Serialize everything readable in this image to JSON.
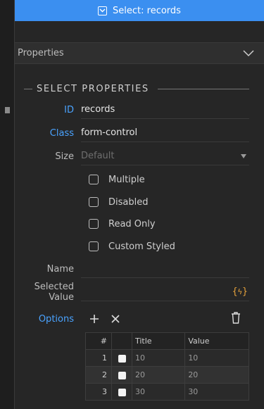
{
  "banner": {
    "label": "Select: records"
  },
  "panel": {
    "title": "Properties"
  },
  "section": {
    "title": "SELECT PROPERTIES"
  },
  "fields": {
    "id": {
      "label": "ID",
      "value": "records"
    },
    "class": {
      "label": "Class",
      "value": "form-control"
    },
    "size": {
      "label": "Size",
      "value": "Default"
    },
    "name": {
      "label": "Name",
      "value": ""
    },
    "selected_value": {
      "label": "Selected Value",
      "value": ""
    }
  },
  "checkboxes": [
    {
      "label": "Multiple",
      "checked": false
    },
    {
      "label": "Disabled",
      "checked": false
    },
    {
      "label": "Read Only",
      "checked": false
    },
    {
      "label": "Custom Styled",
      "checked": false
    }
  ],
  "options": {
    "label": "Options",
    "columns": {
      "index": "#",
      "title": "Title",
      "value": "Value"
    },
    "rows": [
      {
        "index": "1",
        "title": "10",
        "value": "10"
      },
      {
        "index": "2",
        "title": "20",
        "value": "20"
      },
      {
        "index": "3",
        "title": "30",
        "value": "30"
      }
    ]
  },
  "colors": {
    "accent": "#3b8ff0",
    "link": "#4aa3ff",
    "dynamic": "#e6a23c"
  },
  "icons": {
    "banner": "select-box-icon",
    "collapse": "chevron-down-icon",
    "add": "plus-icon",
    "remove": "close-icon",
    "delete": "trash-icon",
    "dynamic": "dynamic-data-icon"
  }
}
